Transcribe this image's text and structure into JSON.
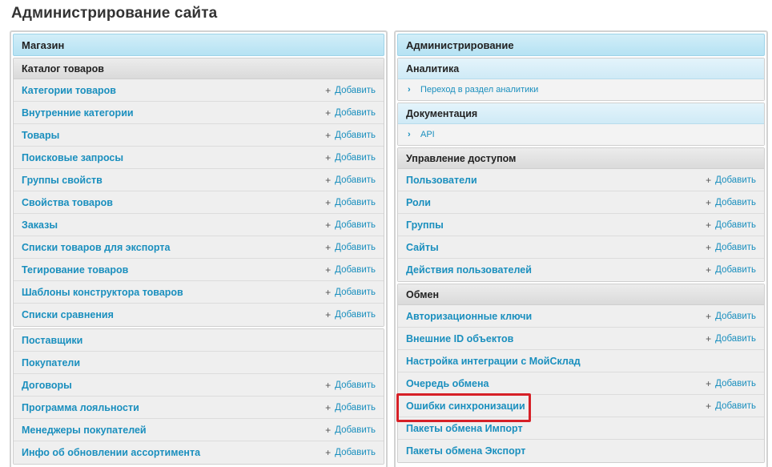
{
  "page_title": "Администрирование сайта",
  "add_label": "Добавить",
  "left": {
    "header": "Магазин",
    "catalog": {
      "title": "Каталог товаров",
      "items": [
        {
          "label": "Категории товаров",
          "add": true
        },
        {
          "label": "Внутренние категории",
          "add": true
        },
        {
          "label": "Товары",
          "add": true
        },
        {
          "label": "Поисковые запросы",
          "add": true
        },
        {
          "label": "Группы свойств",
          "add": true
        },
        {
          "label": "Свойства товаров",
          "add": true
        },
        {
          "label": "Заказы",
          "add": true
        },
        {
          "label": "Списки товаров для экспорта",
          "add": true
        },
        {
          "label": "Тегирование товаров",
          "add": true
        },
        {
          "label": "Шаблоны конструктора товаров",
          "add": true
        },
        {
          "label": "Списки сравнения",
          "add": true
        }
      ]
    },
    "other": {
      "items": [
        {
          "label": "Поставщики",
          "add": false
        },
        {
          "label": "Покупатели",
          "add": false
        },
        {
          "label": "Договоры",
          "add": true
        },
        {
          "label": "Программа лояльности",
          "add": true
        },
        {
          "label": "Менеджеры покупателей",
          "add": true
        },
        {
          "label": "Инфо об обновлении ассортимента",
          "add": true
        }
      ]
    }
  },
  "right": {
    "header": "Администрирование",
    "analytics": {
      "title": "Аналитика",
      "link": "Переход в раздел аналитики"
    },
    "docs": {
      "title": "Документация",
      "link": "API"
    },
    "access": {
      "title": "Управление доступом",
      "items": [
        {
          "label": "Пользователи",
          "add": true
        },
        {
          "label": "Роли",
          "add": true
        },
        {
          "label": "Группы",
          "add": true
        },
        {
          "label": "Сайты",
          "add": true
        },
        {
          "label": "Действия пользователей",
          "add": true
        }
      ]
    },
    "exchange": {
      "title": "Обмен",
      "items": [
        {
          "label": "Авторизационные ключи",
          "add": true
        },
        {
          "label": "Внешние ID объектов",
          "add": true
        },
        {
          "label": "Настройка интеграции с МойСклад",
          "add": false
        },
        {
          "label": "Очередь обмена",
          "add": true
        },
        {
          "label": "Ошибки синхронизации",
          "add": true
        },
        {
          "label": "Пакеты обмена Импорт",
          "add": false
        },
        {
          "label": "Пакеты обмена Экспорт",
          "add": false
        }
      ]
    }
  },
  "colors": {
    "link": "#1a8fbe",
    "highlight": "#d62027",
    "header_blue": "#b5e2f3"
  }
}
